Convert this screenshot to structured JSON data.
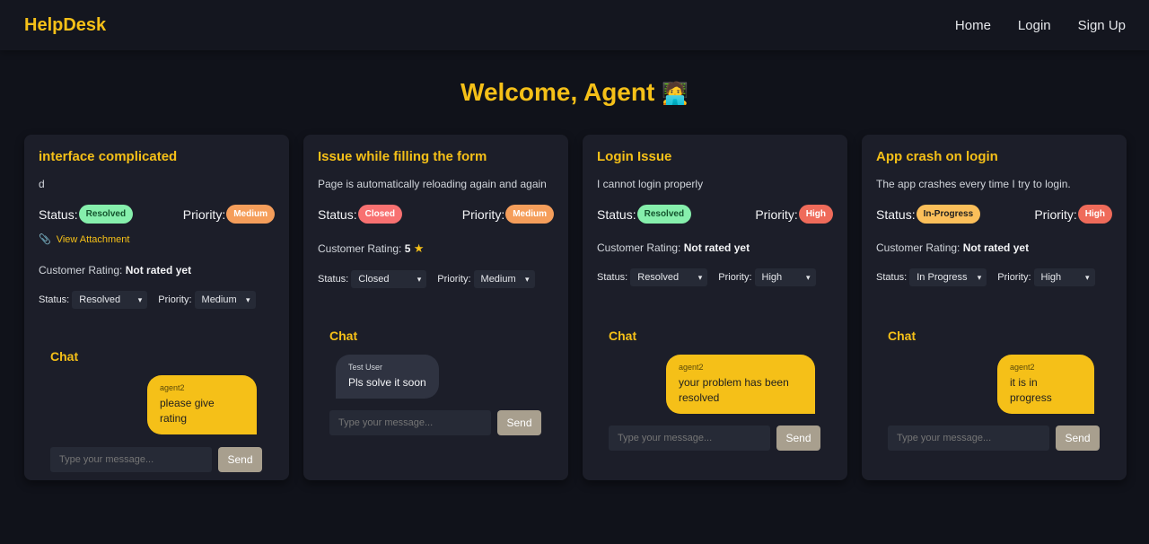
{
  "nav": {
    "brand": "HelpDesk",
    "links": [
      "Home",
      "Login",
      "Sign Up"
    ]
  },
  "welcome": {
    "text": "Welcome, Agent",
    "emoji": "🧑‍💻"
  },
  "labels": {
    "status": "Status:",
    "priority": "Priority:",
    "customer_rating": "Customer Rating:",
    "status_select": "Status:",
    "priority_select": "Priority:",
    "chat": "Chat",
    "attachment": "View Attachment",
    "send": "Send",
    "input_placeholder": "Type your message..."
  },
  "tickets": [
    {
      "title": "interface complicated",
      "description": "d",
      "status_badge": "Resolved",
      "priority_badge": "Medium",
      "rating": "Not rated yet",
      "status_value": "Resolved",
      "priority_value": "Medium",
      "messages": [
        {
          "sender": "agent2",
          "text": "please give rating"
        }
      ]
    },
    {
      "title": "Issue while filling the form",
      "description": "Page is automatically reloading again and again",
      "status_badge": "Closed",
      "priority_badge": "Medium",
      "rating": "5",
      "status_value": "Closed",
      "priority_value": "Medium",
      "messages": [
        {
          "sender": "Test User",
          "text": "Pls solve it soon"
        }
      ]
    },
    {
      "title": "Login Issue",
      "description": "I cannot login properly",
      "status_badge": "Resolved",
      "priority_badge": "High",
      "rating": "Not rated yet",
      "status_value": "Resolved",
      "priority_value": "High",
      "messages": [
        {
          "sender": "agent2",
          "text": "your problem has been resolved"
        }
      ]
    },
    {
      "title": "App crash on login",
      "description": "The app crashes every time I try to login.",
      "status_badge": "In-Progress",
      "priority_badge": "High",
      "rating": "Not rated yet",
      "status_value": "In Progress",
      "priority_value": "High",
      "messages": [
        {
          "sender": "agent2",
          "text": "it is in progress"
        }
      ]
    }
  ],
  "colors": {
    "accent": "#f5c018",
    "background": "#10121a",
    "card": "#1c1e29"
  }
}
